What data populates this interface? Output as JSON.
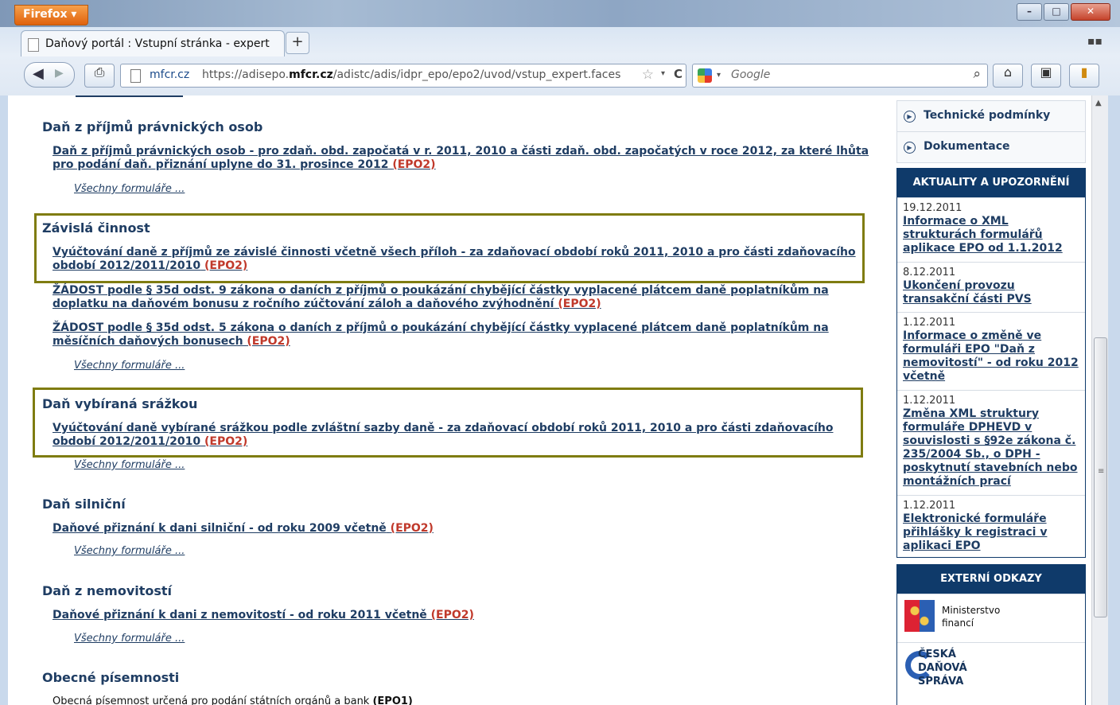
{
  "browser": {
    "app_button": "Firefox",
    "window_controls": [
      "–",
      "□",
      "✕"
    ],
    "tab_title": "Daňový portál : Vstupní stránka - expert",
    "new_tab": "+",
    "address_domain": "mfcr.cz",
    "url_prefix": "https://adisepo.",
    "url_bold": "mfcr.cz",
    "url_suffix": "/adistc/adis/idpr_epo/epo2/uvod/vstup_expert.faces",
    "search_placeholder": "Google"
  },
  "main": {
    "sections": [
      {
        "heading": "Daň z příjmů právnických osob",
        "links": [
          {
            "text": "Daň z příjmů právnických osob - pro zdaň. obd. započatá v r. 2011, 2010 a části zdaň. obd. započatých v roce 2012, za které lhůta pro podání daň. přiznání uplyne do 31. prosince 2012",
            "tag": "(EPO2)"
          }
        ],
        "all_forms": "Všechny formuláře ..."
      },
      {
        "heading": "Závislá činnost",
        "links": [
          {
            "text": "Vyúčtování daně z příjmů ze závislé činnosti včetně všech příloh - za zdaňovací období roků 2011, 2010 a pro části zdaňovacího období 2012/2011/2010",
            "tag": "(EPO2)"
          },
          {
            "text": "ŽÁDOST podle § 35d odst. 9 zákona o daních z příjmů o poukázání chybějící částky vyplacené plátcem daně poplatníkům na doplatku na daňovém bonusu z ročního zúčtování záloh a daňového zvýhodnění",
            "tag": "(EPO2)"
          },
          {
            "text": "ŽÁDOST podle § 35d odst. 5 zákona o daních z příjmů o poukázání chybějící částky vyplacené plátcem daně poplatníkům na měsíčních daňových bonusech",
            "tag": "(EPO2)"
          }
        ],
        "all_forms": "Všechny formuláře ..."
      },
      {
        "heading": "Daň vybíraná srážkou",
        "links": [
          {
            "text": "Vyúčtování daně vybírané srážkou podle zvláštní sazby daně - za zdaňovací období roků 2011, 2010 a pro části zdaňovacího období 2012/2011/2010",
            "tag": "(EPO2)"
          }
        ],
        "all_forms": "Všechny formuláře ..."
      },
      {
        "heading": "Daň silniční",
        "links": [
          {
            "text": "Daňové přiznání k dani silniční - od roku 2009 včetně",
            "tag": "(EPO2)"
          }
        ],
        "all_forms": "Všechny formuláře ..."
      },
      {
        "heading": "Daň z nemovitostí",
        "links": [
          {
            "text": "Daňové přiznání k dani z nemovitostí - od roku 2011 včetně",
            "tag": "(EPO2)"
          }
        ],
        "all_forms": "Všechny formuláře ..."
      },
      {
        "heading": "Obecné písemnosti",
        "plain_text": "Obecná písemnost určená pro podání státních orgánů a bank",
        "plain_tag": "(EPO1)"
      }
    ]
  },
  "sidebar": {
    "nav_items": [
      "Technické podmínky",
      "Dokumentace"
    ],
    "news_heading": "AKTUALITY A UPOZORNĚNÍ",
    "news": [
      {
        "date": "19.12.2011",
        "title": "Informace o XML strukturách formulářů aplikace EPO od 1.1.2012"
      },
      {
        "date": "8.12.2011",
        "title": "Ukončení provozu transakční části PVS"
      },
      {
        "date": "1.12.2011",
        "title": "Informace o změně ve formuláři EPO \"Daň z nemovitostí\" - od roku 2012 včetně"
      },
      {
        "date": "1.12.2011",
        "title": "Změna XML struktury formuláře DPHEVD v souvislosti s §92e zákona č. 235/2004 Sb., o DPH - poskytnutí stavebních nebo montážních prací"
      },
      {
        "date": "1.12.2011",
        "title": "Elektronické formuláře přihlášky k registraci v aplikaci EPO"
      }
    ],
    "external_heading": "EXTERNÍ ODKAZY",
    "external": [
      {
        "line1": "Ministerstvo",
        "line2": "financí"
      },
      {
        "line1": "ČESKÁ",
        "line2": "DAŇOVÁ",
        "line3": "SPRÁVA"
      }
    ]
  }
}
